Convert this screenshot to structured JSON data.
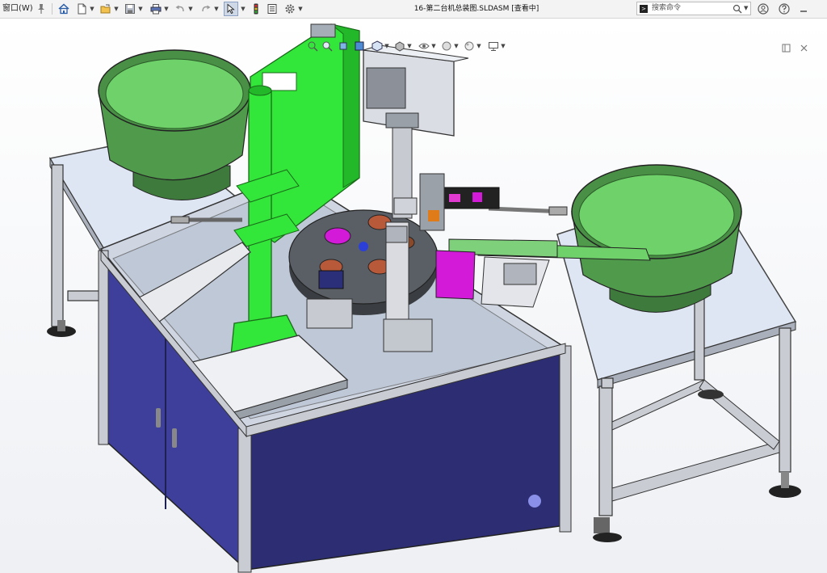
{
  "titlebar": {
    "window_menu": "窗口(W)",
    "title": "16-第二台机总装图.SLDASM [查看中]",
    "search_placeholder": "搜索命令",
    "search_prompt_glyph": ">"
  },
  "icons": {
    "pin": "pin-icon",
    "home": "home-icon",
    "new": "new-document-icon",
    "open": "open-folder-icon",
    "save": "save-icon",
    "print": "print-icon",
    "undo": "undo-icon",
    "redo": "redo-icon",
    "select": "select-arrow-icon",
    "rebuild": "traffic-light-icon",
    "file_properties": "file-properties-icon",
    "options": "gear-icon",
    "help": "help-icon",
    "account": "account-icon",
    "minimize": "minimize-icon",
    "close": "close-icon"
  },
  "colors": {
    "feeder_green": "#6fd16a",
    "feeder_dark_green": "#3e7a3c",
    "press_green": "#33e63a",
    "cabinet_blue": "#3d3f9a",
    "cabinet_dark": "#2c2d72",
    "frame_silver": "#c9ccd3",
    "table_top": "#dfe6f3",
    "magenta": "#d21ad8",
    "turntable": "#5a5f66"
  }
}
